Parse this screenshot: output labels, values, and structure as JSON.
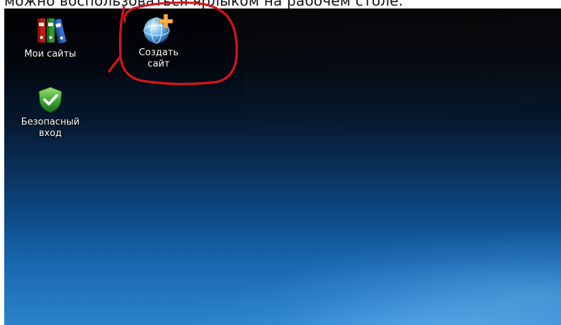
{
  "caption": {
    "text": "можно воспользоваться ярлыком на рабочем столе."
  },
  "desktop": {
    "icons": [
      {
        "label": "Мои сайты",
        "icon": "folders-icon"
      },
      {
        "label": "Создать\nсайт",
        "icon": "globe-add-icon"
      },
      {
        "label": "Безопасный\nвход",
        "icon": "shield-check-icon"
      }
    ]
  },
  "annotation": {
    "color": "#d8141c",
    "shape": "hand-drawn-circle"
  }
}
